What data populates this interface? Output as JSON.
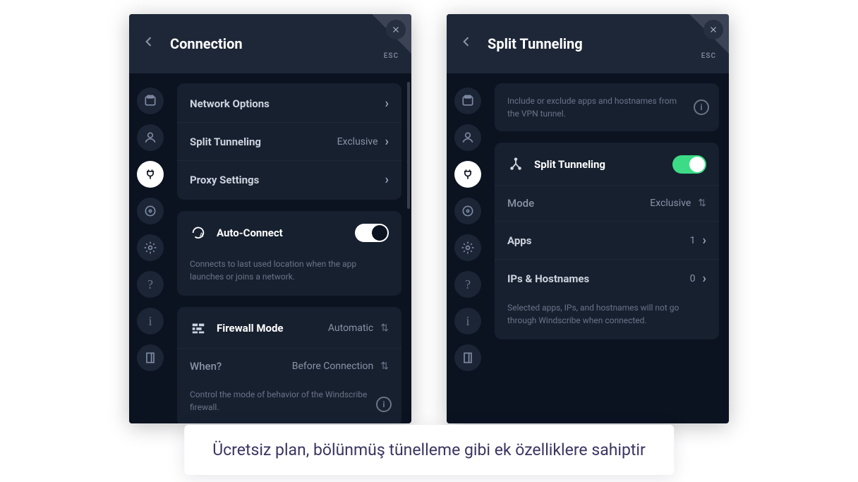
{
  "panels": [
    {
      "title": "Connection",
      "esc": "ESC",
      "sidebar_active": 2,
      "rows1": [
        {
          "label": "Network Options",
          "value": ""
        },
        {
          "label": "Split Tunneling",
          "value": "Exclusive"
        },
        {
          "label": "Proxy Settings",
          "value": ""
        }
      ],
      "autoconnect": {
        "label": "Auto-Connect",
        "on": true,
        "desc": "Connects to last used location when the app launches or joins a network."
      },
      "firewall": {
        "label": "Firewall Mode",
        "value": "Automatic",
        "when_label": "When?",
        "when_value": "Before Connection",
        "desc": "Control the mode of behavior of the Windscribe firewall."
      }
    },
    {
      "title": "Split Tunneling",
      "esc": "ESC",
      "sidebar_active": 2,
      "info": "Include or exclude apps and hostnames from the VPN tunnel.",
      "toggle": {
        "label": "Split Tunneling",
        "on": true
      },
      "mode": {
        "label": "Mode",
        "value": "Exclusive"
      },
      "apps": {
        "label": "Apps",
        "value": "1"
      },
      "hosts": {
        "label": "IPs & Hostnames",
        "value": "0"
      },
      "footer": "Selected apps, IPs, and hostnames will not go through Windscribe when connected."
    }
  ],
  "caption": "Ücretsiz plan, bölünmüş tünelleme gibi ek özelliklere sahiptir"
}
